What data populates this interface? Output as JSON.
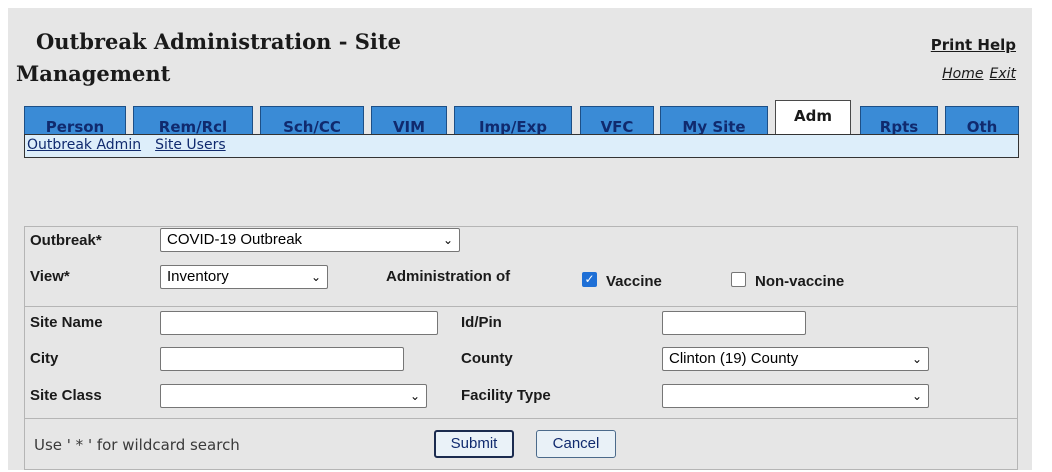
{
  "header": {
    "title_line1": "Outbreak Administration - Site",
    "title_line2": "Management",
    "print_help": "Print Help",
    "home": "Home",
    "exit": "Exit"
  },
  "tabs": [
    {
      "label": "Person"
    },
    {
      "label": "Rem/Rcl"
    },
    {
      "label": "Sch/CC"
    },
    {
      "label": "VIM"
    },
    {
      "label": "Imp/Exp"
    },
    {
      "label": "VFC"
    },
    {
      "label": "My Site"
    },
    {
      "label": "Adm",
      "active": true
    },
    {
      "label": "Rpts"
    },
    {
      "label": "Oth"
    }
  ],
  "subnav": {
    "outbreak_admin": "Outbreak Admin",
    "site_users": "Site Users"
  },
  "form": {
    "outbreak_label": "Outbreak*",
    "outbreak_value": "COVID-19 Outbreak",
    "view_label": "View*",
    "view_value": "Inventory",
    "administration_label": "Administration of",
    "vaccine_label": "Vaccine",
    "vaccine_checked": true,
    "nonvaccine_label": "Non-vaccine",
    "nonvaccine_checked": false,
    "site_name_label": "Site Name",
    "site_name_value": "",
    "idpin_label": "Id/Pin",
    "idpin_value": "",
    "city_label": "City",
    "city_value": "",
    "county_label": "County",
    "county_value": "Clinton (19) County",
    "site_class_label": "Site Class",
    "site_class_value": "",
    "facility_type_label": "Facility Type",
    "facility_type_value": "",
    "wildcard_hint": "Use ' * ' for wildcard search",
    "submit": "Submit",
    "cancel": "Cancel"
  },
  "icons": {
    "dropdown": "chevron-down-icon",
    "checkbox": "checkmark-icon"
  },
  "colors": {
    "tab_bg": "#3a8bd6",
    "tab_text": "#102a6e",
    "subnav_bg": "#ddeefa",
    "panel_bg": "#e6e6e6",
    "checkbox_on": "#1e6fd6"
  }
}
